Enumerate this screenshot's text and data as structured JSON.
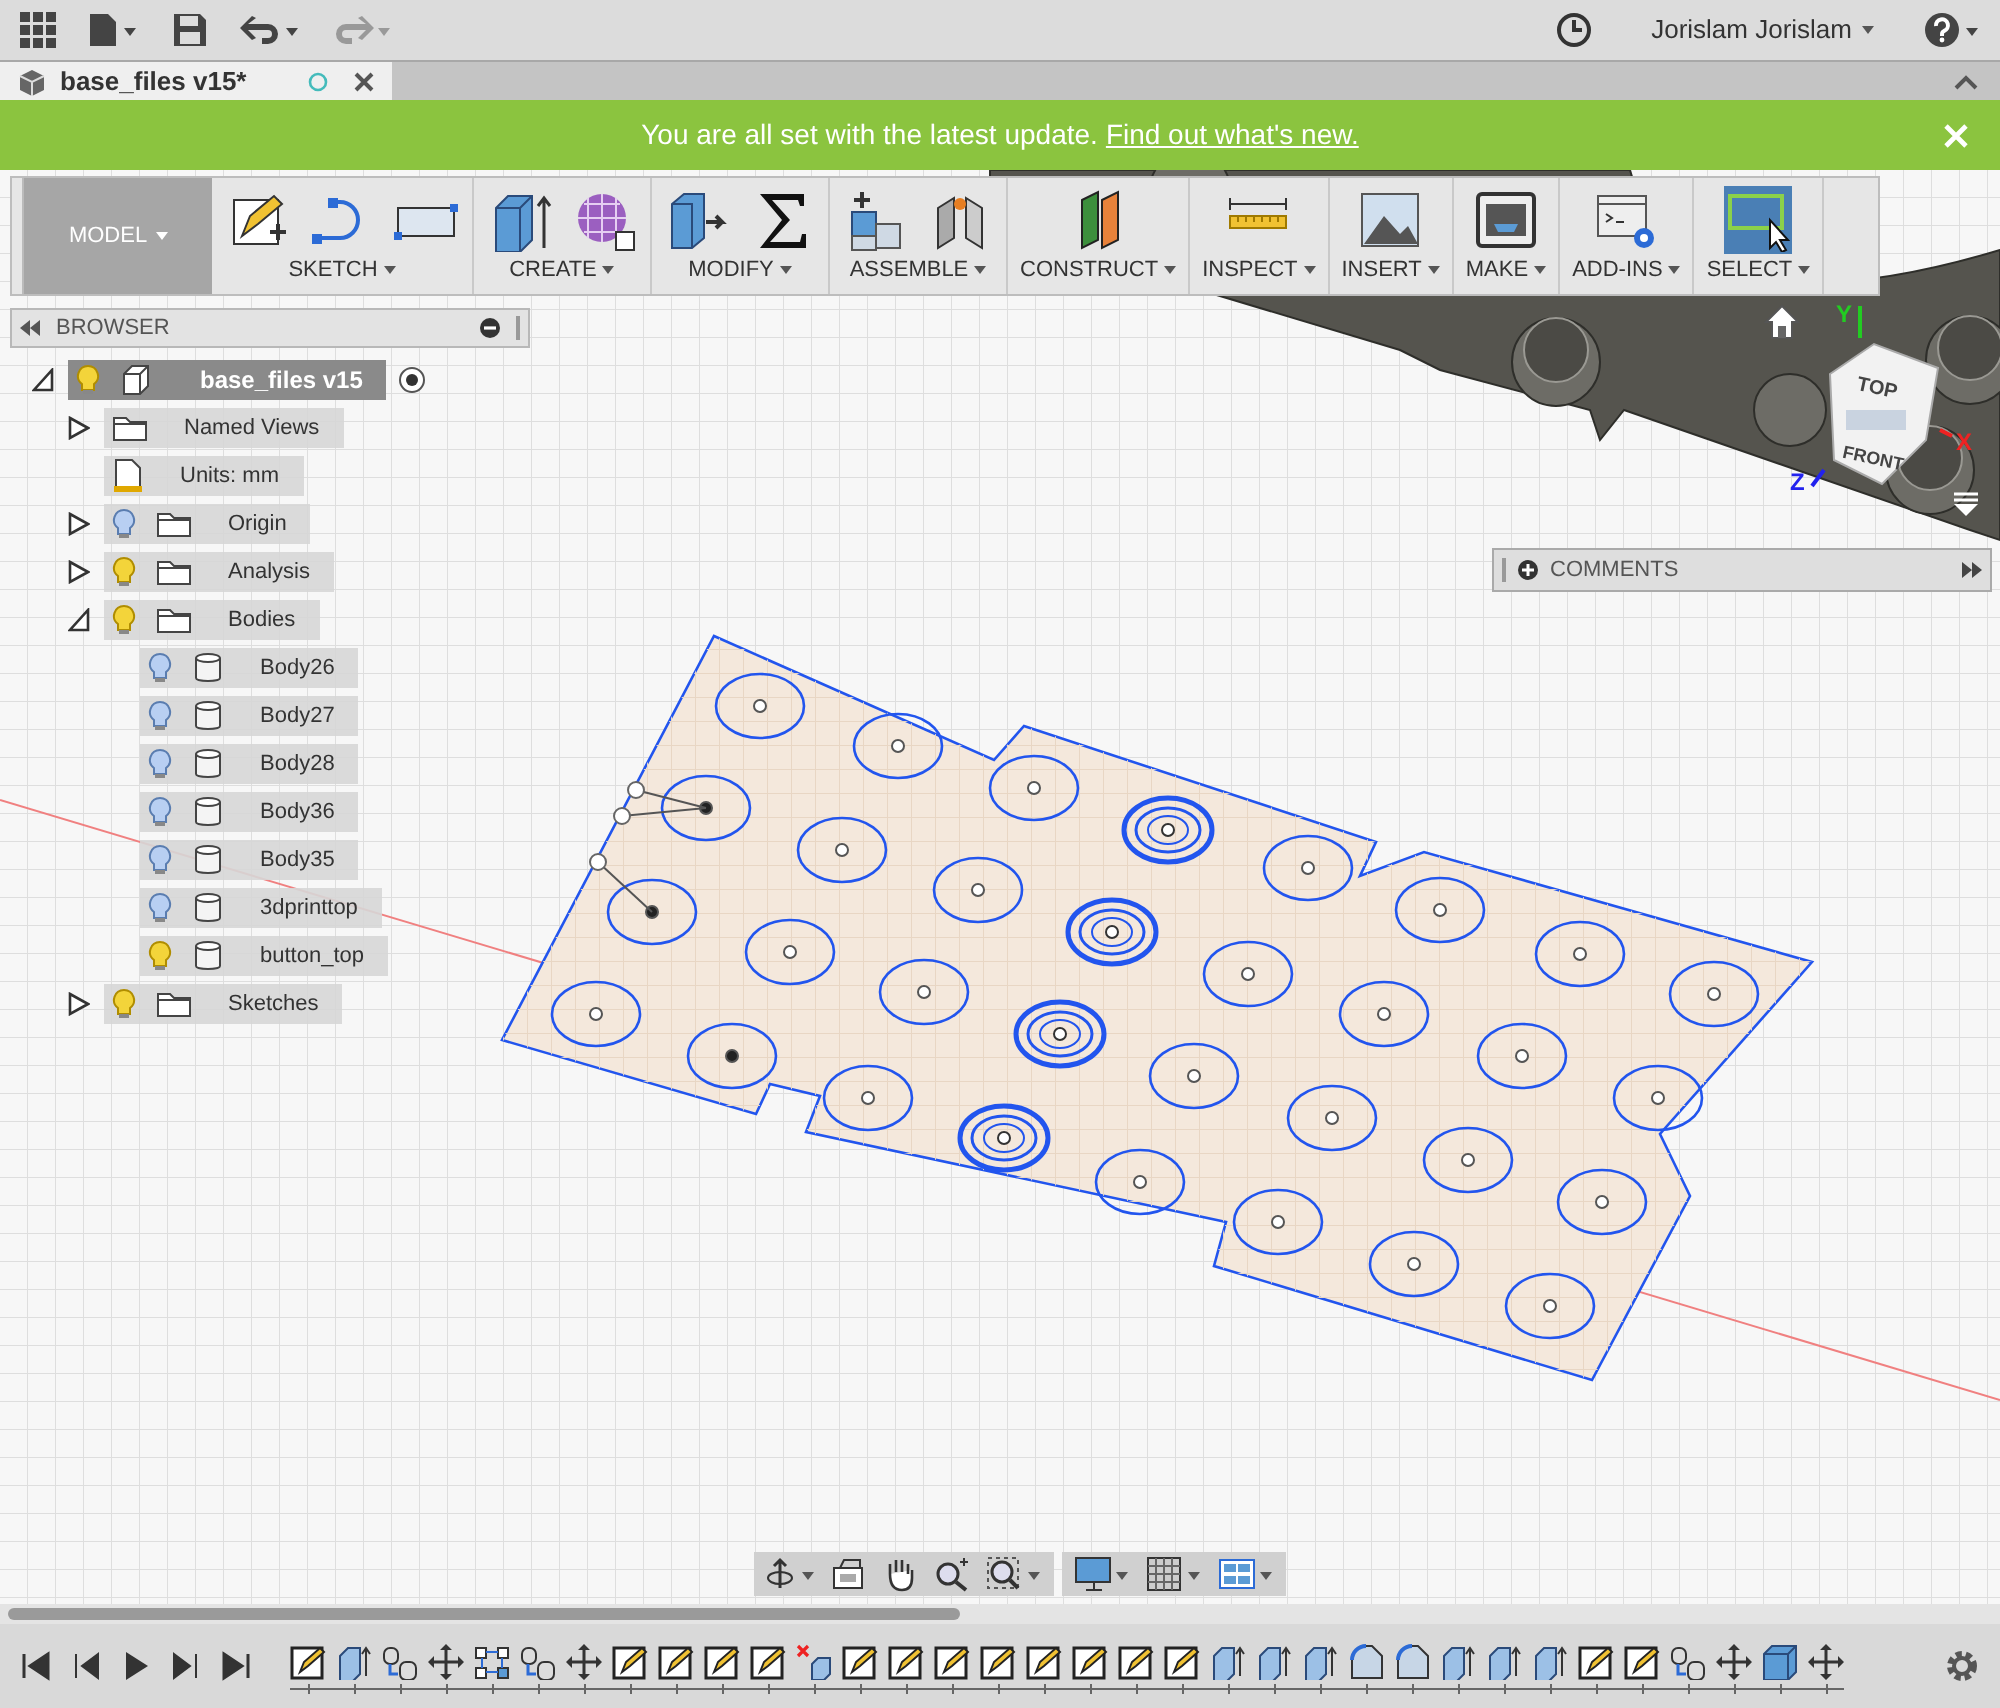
{
  "top_bar": {
    "user": "Jorislam Jorislam"
  },
  "document_tab": {
    "title": "base_files v15*",
    "selected": true
  },
  "banner": {
    "message": "You are all set with the latest update.",
    "link": "Find out what's new."
  },
  "toolbar": {
    "workspace": "MODEL",
    "groups": [
      {
        "label": "SKETCH",
        "tools": [
          {
            "kind": "sketch"
          },
          {
            "kind": "arc"
          },
          {
            "kind": "rectangle"
          }
        ]
      },
      {
        "label": "CREATE",
        "tools": [
          {
            "kind": "extrude"
          },
          {
            "kind": "form"
          }
        ]
      },
      {
        "label": "MODIFY",
        "tools": [
          {
            "kind": "pushpull"
          },
          {
            "kind": "sigma"
          }
        ]
      },
      {
        "label": "ASSEMBLE",
        "tools": [
          {
            "kind": "component"
          },
          {
            "kind": "joint"
          }
        ]
      },
      {
        "label": "CONSTRUCT",
        "tools": [
          {
            "kind": "plane"
          }
        ]
      },
      {
        "label": "INSPECT",
        "tools": [
          {
            "kind": "measure"
          }
        ]
      },
      {
        "label": "INSERT",
        "tools": [
          {
            "kind": "image"
          }
        ]
      },
      {
        "label": "MAKE",
        "tools": [
          {
            "kind": "printer"
          }
        ]
      },
      {
        "label": "ADD-INS",
        "tools": [
          {
            "kind": "script"
          }
        ]
      },
      {
        "label": "SELECT",
        "tools": [
          {
            "kind": "select",
            "selected": true
          }
        ]
      }
    ]
  },
  "browser": {
    "title": "BROWSER",
    "tree": [
      {
        "label": "base_files v15",
        "kind": "component",
        "visible": true,
        "expanded": true,
        "children": [
          {
            "label": "Named Views",
            "kind": "folder",
            "expanded": false
          },
          {
            "label": "Units: mm",
            "kind": "units"
          },
          {
            "label": "Origin",
            "kind": "folder",
            "visible": false,
            "expanded": false
          },
          {
            "label": "Analysis",
            "kind": "folder",
            "visible": true,
            "expanded": false
          },
          {
            "label": "Bodies",
            "kind": "folder",
            "visible": true,
            "expanded": true,
            "children": [
              {
                "label": "Body26",
                "kind": "body",
                "visible": false
              },
              {
                "label": "Body27",
                "kind": "body",
                "visible": false
              },
              {
                "label": "Body28",
                "kind": "body",
                "visible": false
              },
              {
                "label": "Body36",
                "kind": "body",
                "visible": false
              },
              {
                "label": "Body35",
                "kind": "body",
                "visible": false
              },
              {
                "label": "3dprinttop",
                "kind": "body",
                "visible": false
              },
              {
                "label": "button_top",
                "kind": "body",
                "visible": true
              }
            ]
          },
          {
            "label": "Sketches",
            "kind": "folder",
            "visible": true,
            "expanded": false
          }
        ]
      }
    ]
  },
  "view_cube": {
    "top": "TOP",
    "front": "FRONT",
    "axes": [
      "X",
      "Y",
      "Z"
    ]
  },
  "comments": {
    "title": "COMMENTS"
  },
  "timeline": {
    "features": [
      {
        "kind": "sketch"
      },
      {
        "kind": "extrude"
      },
      {
        "kind": "joint"
      },
      {
        "kind": "move"
      },
      {
        "kind": "pattern"
      },
      {
        "kind": "joint"
      },
      {
        "kind": "move"
      },
      {
        "kind": "sketch"
      },
      {
        "kind": "sketch"
      },
      {
        "kind": "sketch"
      },
      {
        "kind": "sketch"
      },
      {
        "kind": "delete"
      },
      {
        "kind": "sketch"
      },
      {
        "kind": "sketch"
      },
      {
        "kind": "sketch"
      },
      {
        "kind": "sketch"
      },
      {
        "kind": "sketch"
      },
      {
        "kind": "sketch"
      },
      {
        "kind": "sketch"
      },
      {
        "kind": "sketch"
      },
      {
        "kind": "extrude"
      },
      {
        "kind": "extrude"
      },
      {
        "kind": "extrude"
      },
      {
        "kind": "fillet"
      },
      {
        "kind": "fillet"
      },
      {
        "kind": "extrude"
      },
      {
        "kind": "extrude"
      },
      {
        "kind": "extrude"
      },
      {
        "kind": "sketch"
      },
      {
        "kind": "sketch"
      },
      {
        "kind": "joint"
      },
      {
        "kind": "move"
      },
      {
        "kind": "box"
      },
      {
        "kind": "move"
      }
    ]
  }
}
